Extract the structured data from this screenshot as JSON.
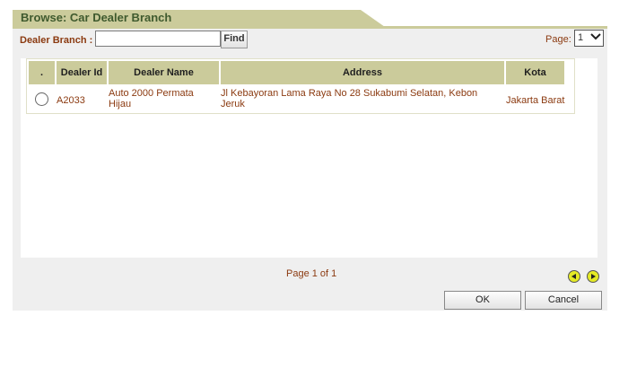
{
  "title": "Browse: Car Dealer Branch",
  "filter": {
    "label": "Dealer Branch :",
    "value": "",
    "find_label": "Find"
  },
  "page": {
    "label": "Page:",
    "selected": "1"
  },
  "table": {
    "columns": [
      ".",
      "Dealer Id",
      "Dealer Name",
      "Address",
      "Kota"
    ],
    "rows": [
      {
        "dealer_id": "A2033",
        "dealer_name": "Auto 2000 Permata Hijau",
        "address": "Jl Kebayoran Lama Raya No 28 Sukabumi Selatan, Kebon Jeruk",
        "kota": "Jakarta Barat"
      }
    ]
  },
  "pager": {
    "text": "Page 1 of 1"
  },
  "buttons": {
    "ok": "OK",
    "cancel": "Cancel"
  },
  "colors": {
    "header_bg": "#cbcb9b",
    "title_text": "#3f5a2e",
    "cell_text": "#8b3a10",
    "nav_btn": "#e4ea26"
  }
}
